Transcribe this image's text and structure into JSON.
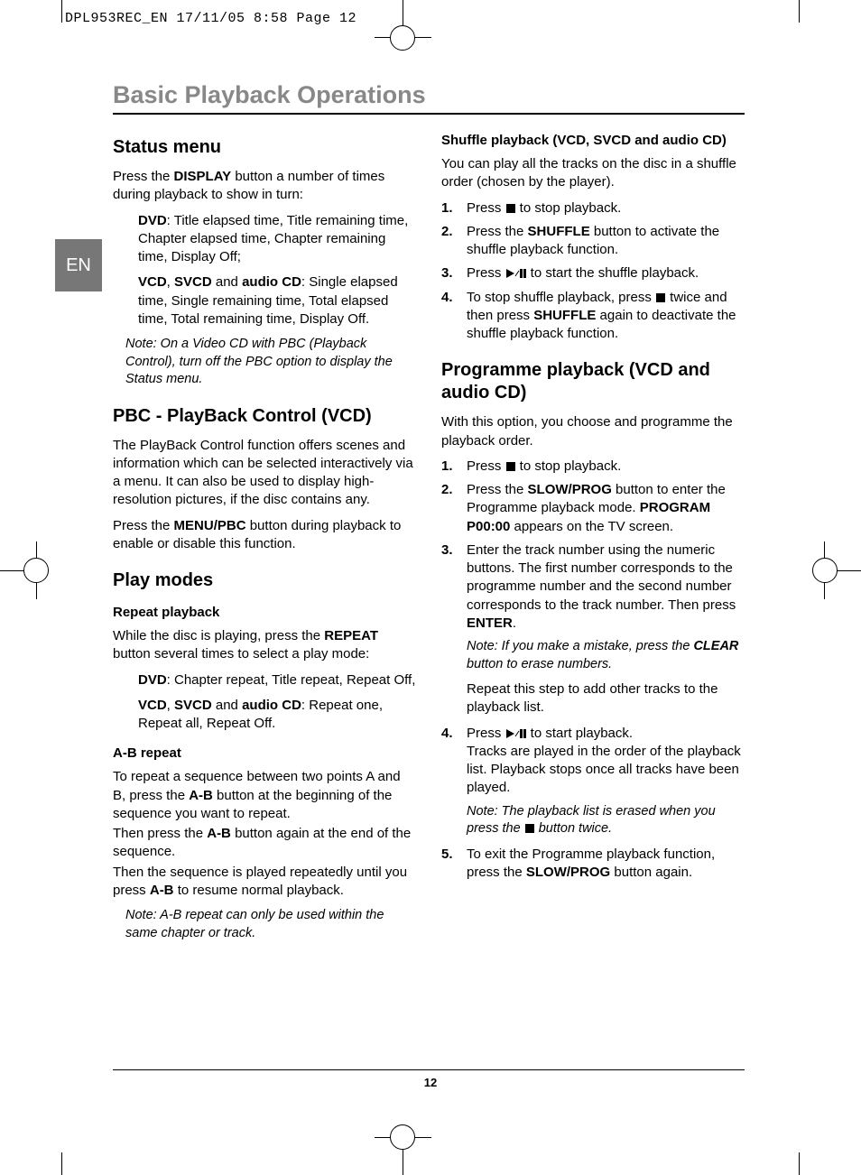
{
  "slug": "DPL953REC_EN  17/11/05  8:58  Page 12",
  "lang_tab": "EN",
  "page_number": "12",
  "title": "Basic Playback Operations",
  "left": {
    "status_h": "Status menu",
    "status_p1a": "Press the ",
    "status_p1_bold": "DISPLAY",
    "status_p1b": " button a number of times during playback to show in turn:",
    "status_dvd_bold": "DVD",
    "status_dvd_txt": ": Title elapsed time, Title remaining time, Chapter elapsed time, Chapter remaining time, Display Off;",
    "status_vcd_b1": "VCD",
    "status_vcd_t1": ", ",
    "status_vcd_b2": "SVCD",
    "status_vcd_t2": " and ",
    "status_vcd_b3": "audio CD",
    "status_vcd_txt": ": Single elapsed time, Single remaining time, Total elapsed time, Total remaining time, Display Off.",
    "status_note": "Note: On a Video CD with PBC (Playback Control), turn off the PBC option to display the Status menu.",
    "pbc_h": "PBC - PlayBack Control (VCD)",
    "pbc_p1": "The PlayBack Control function offers scenes and information which can be selected interactively via a menu. It can also be used to display high-resolution pictures, if the disc contains any.",
    "pbc_p2a": "Press the ",
    "pbc_p2_bold": "MENU/PBC",
    "pbc_p2b": " button during playback to enable or disable this function.",
    "play_h": "Play modes",
    "repeat_h": "Repeat playback",
    "repeat_p1a": "While the disc is playing, press the ",
    "repeat_p1_bold": "REPEAT",
    "repeat_p1b": " button several times to select a play mode:",
    "repeat_dvd_bold": "DVD",
    "repeat_dvd_txt": ": Chapter repeat, Title repeat, Repeat Off,",
    "repeat_vcd_b1": "VCD",
    "repeat_vcd_t1": ", ",
    "repeat_vcd_b2": "SVCD",
    "repeat_vcd_t2": " and ",
    "repeat_vcd_b3": "audio CD",
    "repeat_vcd_txt": ": Repeat one, Repeat all, Repeat Off.",
    "ab_h": "A-B repeat",
    "ab_p1a": "To repeat a sequence between two points A and B, press the ",
    "ab_p1_bold": "A-B",
    "ab_p1b": " button at the beginning of the sequence you want to repeat.",
    "ab_p2a": "Then press the ",
    "ab_p2_bold": "A-B",
    "ab_p2b": " button again at the end of the sequence.",
    "ab_p3a": "Then the sequence is played repeatedly until you press ",
    "ab_p3_bold": "A-B",
    "ab_p3b": " to resume normal playback.",
    "ab_note": "Note: A-B repeat can only be used within the same chapter or track."
  },
  "right": {
    "shuffle_h": "Shuffle playback (VCD, SVCD and audio CD)",
    "shuffle_p1": "You can play all the tracks on the disc in a shuffle order (chosen by the player).",
    "sh1a": "Press ",
    "sh1b": " to stop playback.",
    "sh2a": "Press the ",
    "sh2_bold": "SHUFFLE",
    "sh2b": " button to activate the shuffle playback function.",
    "sh3a": "Press ",
    "sh3b": " to start the shuffle playback.",
    "sh4a": "To stop shuffle playback, press ",
    "sh4b": " twice and then press ",
    "sh4_bold": "SHUFFLE",
    "sh4c": " again to deactivate the shuffle playback function.",
    "prog_h": "Programme playback (VCD and audio CD)",
    "prog_p1": "With this option, you choose and programme the playback order.",
    "pr1a": "Press ",
    "pr1b": " to stop playback.",
    "pr2a": "Press the ",
    "pr2_bold1": "SLOW/PROG",
    "pr2b": " button to enter the Programme playback mode. ",
    "pr2_bold2": "PROGRAM P00:00",
    "pr2c": " appears on the TV screen.",
    "pr3a": "Enter the track number using the numeric buttons. The first number corresponds to the programme number and the second number corresponds to the track number. Then press ",
    "pr3_bold": "ENTER",
    "pr3b": ".",
    "pr_note1a": "Note: If you make a mistake, press the ",
    "pr_note1_bold": "CLEAR",
    "pr_note1b": " button to erase numbers.",
    "pr_repeat": "Repeat this step to add other tracks to the playback list.",
    "pr4a": "Press ",
    "pr4b": " to start playback.",
    "pr4c": "Tracks are played in the order of the playback list. Playback stops once all tracks have been played.",
    "pr_note2a": "Note: The playback list is erased when you press the ",
    "pr_note2b": " button twice.",
    "pr5a": "To exit the Programme playback function, press the ",
    "pr5_bold": "SLOW/PROG",
    "pr5b": " button again."
  }
}
